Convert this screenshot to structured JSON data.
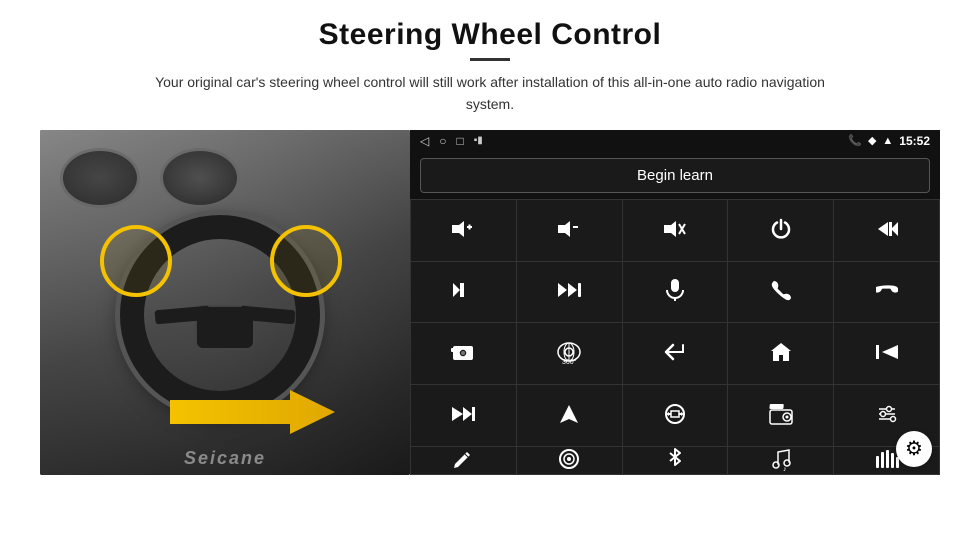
{
  "page": {
    "title": "Steering Wheel Control",
    "subtitle": "Your original car's steering wheel control will still work after installation of this all-in-one auto radio navigation system.",
    "divider_width": 40
  },
  "status_bar": {
    "time": "15:52",
    "nav_icons": [
      "◁",
      "○",
      "□",
      "▪▮"
    ]
  },
  "begin_learn": {
    "label": "Begin learn"
  },
  "control_buttons": [
    {
      "icon": "🔊+",
      "label": "vol-up"
    },
    {
      "icon": "🔊−",
      "label": "vol-down"
    },
    {
      "icon": "🔇",
      "label": "mute"
    },
    {
      "icon": "⏻",
      "label": "power"
    },
    {
      "icon": "⏮",
      "label": "prev-track-end"
    },
    {
      "icon": "⏭",
      "label": "next"
    },
    {
      "icon": "⏭⏭",
      "label": "fast-fwd"
    },
    {
      "icon": "🎙",
      "label": "mic"
    },
    {
      "icon": "📞",
      "label": "call"
    },
    {
      "icon": "↩",
      "label": "hang-up"
    },
    {
      "icon": "📷",
      "label": "camera"
    },
    {
      "icon": "👁360",
      "label": "360-view"
    },
    {
      "icon": "↩",
      "label": "back"
    },
    {
      "icon": "🏠",
      "label": "home"
    },
    {
      "icon": "⏮",
      "label": "skip-back"
    },
    {
      "icon": "⏭⏭",
      "label": "ff2"
    },
    {
      "icon": "➤",
      "label": "nav"
    },
    {
      "icon": "⇄",
      "label": "source"
    },
    {
      "icon": "📻",
      "label": "radio"
    },
    {
      "icon": "🎚",
      "label": "equalizer"
    },
    {
      "icon": "✏",
      "label": "edit"
    },
    {
      "icon": "⏺",
      "label": "record"
    },
    {
      "icon": "✱",
      "label": "bluetooth"
    },
    {
      "icon": "🎵",
      "label": "music"
    },
    {
      "icon": "▊▊▊",
      "label": "spectrum"
    }
  ],
  "watermark": "Seicane",
  "settings": {
    "icon": "⚙"
  }
}
